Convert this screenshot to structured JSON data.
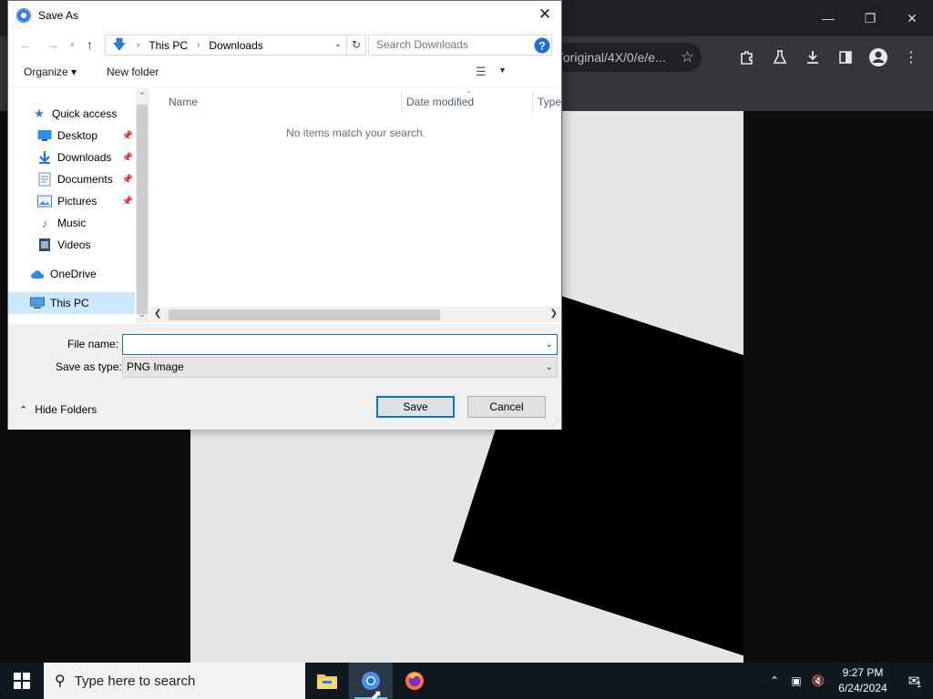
{
  "browser": {
    "address_text": "/original/4X/0/e/e...",
    "toolbar_icons": [
      "extensions-icon",
      "labs-icon",
      "download-icon",
      "sidepanel-icon",
      "profile-icon",
      "menu-icon"
    ]
  },
  "dialog": {
    "title": "Save As",
    "breadcrumb": [
      "This PC",
      "Downloads"
    ],
    "search_placeholder": "Search Downloads",
    "commands": {
      "organize": "Organize ▾",
      "new_folder": "New folder"
    },
    "nav_items": [
      {
        "label": "Quick access",
        "icon": "star-icon",
        "pinned": false
      },
      {
        "label": "Desktop",
        "icon": "desktop-icon",
        "pinned": true
      },
      {
        "label": "Downloads",
        "icon": "download-icon",
        "pinned": true
      },
      {
        "label": "Documents",
        "icon": "document-icon",
        "pinned": true
      },
      {
        "label": "Pictures",
        "icon": "pictures-icon",
        "pinned": true
      },
      {
        "label": "Music",
        "icon": "music-icon",
        "pinned": false
      },
      {
        "label": "Videos",
        "icon": "video-icon",
        "pinned": false
      },
      {
        "label": "OneDrive",
        "icon": "cloud-icon",
        "pinned": false
      },
      {
        "label": "This PC",
        "icon": "computer-icon",
        "pinned": false,
        "selected": true
      }
    ],
    "columns": [
      "Name",
      "Date modified",
      "Type"
    ],
    "empty_message": "No items match your search.",
    "file_name_label": "File name:",
    "file_name_value": "",
    "save_type_label": "Save as type:",
    "save_type_value": "PNG Image",
    "hide_folders": "Hide Folders",
    "save_button": "Save",
    "cancel_button": "Cancel"
  },
  "taskbar": {
    "search_placeholder": "Type here to search",
    "time": "9:27 PM",
    "date": "6/24/2024",
    "notification_count": "1",
    "accent": "#76b9ed"
  }
}
